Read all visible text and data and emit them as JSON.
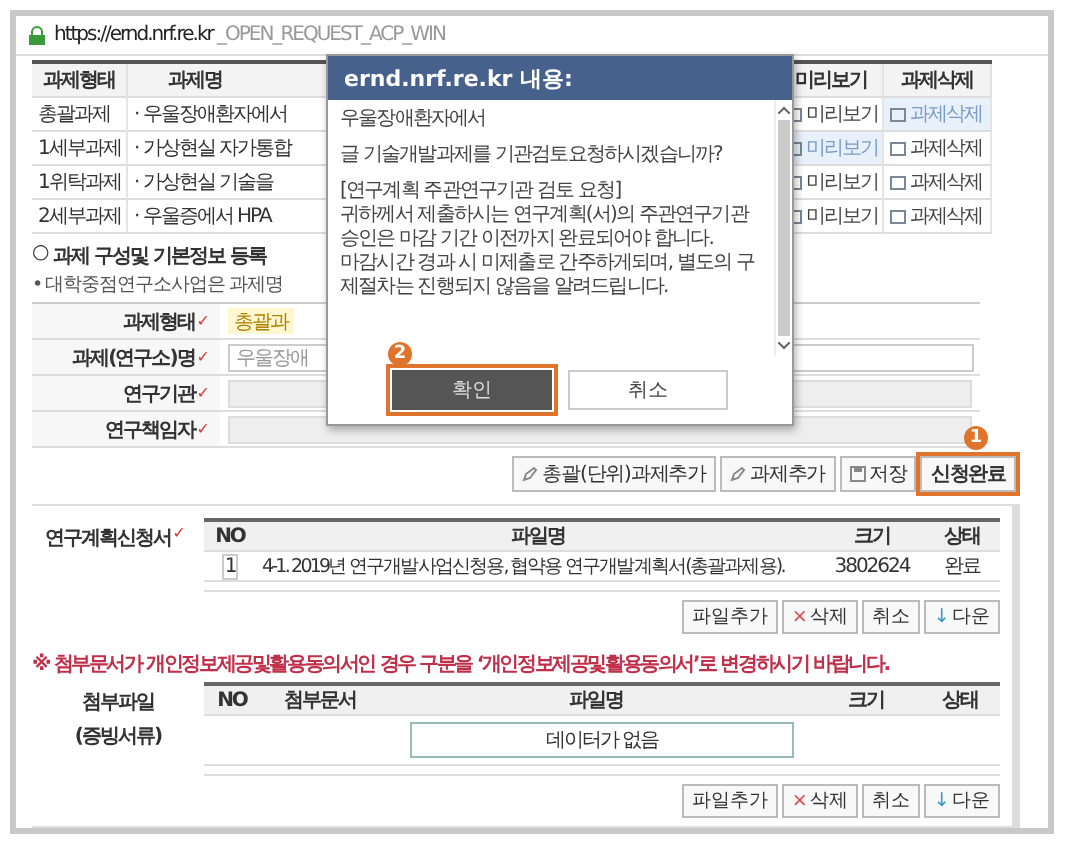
{
  "browser": {
    "url_host": "https://ernd.nrf.re.kr",
    "url_rest": " _OPEN_REQUEST_ACP_WIN"
  },
  "task_table": {
    "columns": [
      "과제형태",
      "과제명",
      "미리보기",
      "과제삭제"
    ],
    "rows": [
      {
        "type": "총괄과제",
        "name": "· 우울장애환자에서",
        "preview": "미리보기",
        "delete": "과제삭제",
        "preview_active": false,
        "delete_active": true
      },
      {
        "type": "1세부과제",
        "name": "· 가상현실 자가통합",
        "preview": "미리보기",
        "delete": "과제삭제",
        "preview_active": true,
        "delete_active": false
      },
      {
        "type": "1위탁과제",
        "name": "· 가상현실 기술을",
        "preview": "미리보기",
        "delete": "과제삭제",
        "preview_active": false,
        "delete_active": false
      },
      {
        "type": "2세부과제",
        "name": "· 우울증에서 HPA",
        "preview": "미리보기",
        "delete": "과제삭제",
        "preview_active": false,
        "delete_active": false
      }
    ]
  },
  "section": {
    "bullet": "○",
    "title": "과제 구성및 기본정보 등록",
    "note": "• 대학중점연구소사업은 과제명"
  },
  "form": [
    {
      "label": "과제형태",
      "mark": "✓",
      "kind": "highlight",
      "value": "총괄과"
    },
    {
      "label": "과제(연구소)명",
      "mark": "✓",
      "kind": "text",
      "value": "우울장애"
    },
    {
      "label": "연구기관",
      "mark": "✓",
      "kind": "empty"
    },
    {
      "label": "연구책임자",
      "mark": "✓",
      "kind": "empty"
    }
  ],
  "actions": [
    {
      "label": "총괄(단위)과제추가",
      "kind": "add",
      "highlighted": false
    },
    {
      "label": "과제추가",
      "kind": "add",
      "highlighted": false
    },
    {
      "label": "저장",
      "kind": "save",
      "highlighted": false
    },
    {
      "label": "신청완료",
      "kind": "submit",
      "highlighted": true,
      "step": "1"
    }
  ],
  "plan_files": {
    "label": "연구계획신청서",
    "mark": "✓",
    "columns": [
      "NO",
      "파일명",
      "크기",
      "상태"
    ],
    "rows": [
      {
        "no": "1",
        "name": "4-1. 2019년 연구개발사업신청용, 협약용 연구개발계획서(총괄과제용).",
        "size": "3802624",
        "status": "완료"
      }
    ],
    "buttons": [
      {
        "label": "파일추가"
      },
      {
        "label": "삭제",
        "icon": "×"
      },
      {
        "label": "취소"
      },
      {
        "label": "다운",
        "icon": "↓"
      }
    ]
  },
  "notice": "※ 첨부문서가 개인정보제공및활용동의서인 경우 구분을 ‘개인정보제공및활용동의서’로 변경하시기 바랍니다.",
  "attachments": {
    "label": "첨부파일",
    "sublabel": "(증빙서류)",
    "columns": [
      "NO",
      "첨부문서",
      "파일명",
      "크기",
      "상태"
    ],
    "empty": "데이터가 없음",
    "buttons": [
      {
        "label": "파일추가"
      },
      {
        "label": "삭제",
        "icon": "×"
      },
      {
        "label": "취소"
      },
      {
        "label": "다운",
        "icon": "↓"
      }
    ]
  },
  "dialog": {
    "title": "ernd.nrf.re.kr 내용:",
    "paragraphs": [
      "우울장애환자에서",
      "글 기술개발과제를 기관검토요청하시겠습니까?",
      "[연구계획 주관연구기관 검토 요청]\n귀하께서 제출하시는 연구계획(서)의 주관연구기관 승인은 마감 기간 이전까지 완료되어야 합니다.\n마감시간 경과 시 미제출로 간주하게되며, 별도의 구제절차는 진행되지 않음을 알려드립니다."
    ],
    "buttons": [
      {
        "label": "확인",
        "selected": true,
        "step": "2"
      },
      {
        "label": "취소",
        "selected": false
      }
    ]
  }
}
